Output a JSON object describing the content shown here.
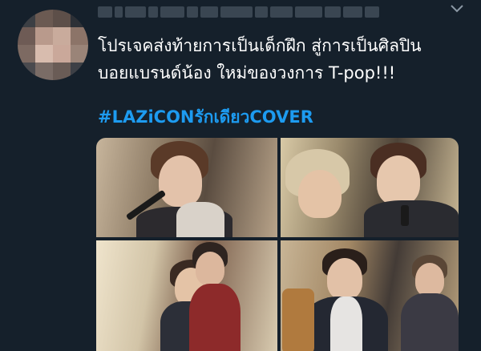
{
  "tweet": {
    "text_line1": "โปรเจคส่งท้ายการเป็นเด็กฝึก สู่การเป็นศิลปิน",
    "text_line2": "บอยแบรนด์น้อง ใหม่ของวงการ T-pop!!!",
    "hashtag": "#LAZiCONรักเดียวCOVER",
    "more_icon": "chevron-down-icon"
  },
  "colors": {
    "background": "#15202b",
    "text": "#ffffff",
    "link": "#1d9bf0",
    "muted": "#8b98a5"
  },
  "media": {
    "photos": [
      {
        "name": "photo-1"
      },
      {
        "name": "photo-2"
      },
      {
        "name": "photo-3"
      },
      {
        "name": "photo-4"
      }
    ]
  }
}
